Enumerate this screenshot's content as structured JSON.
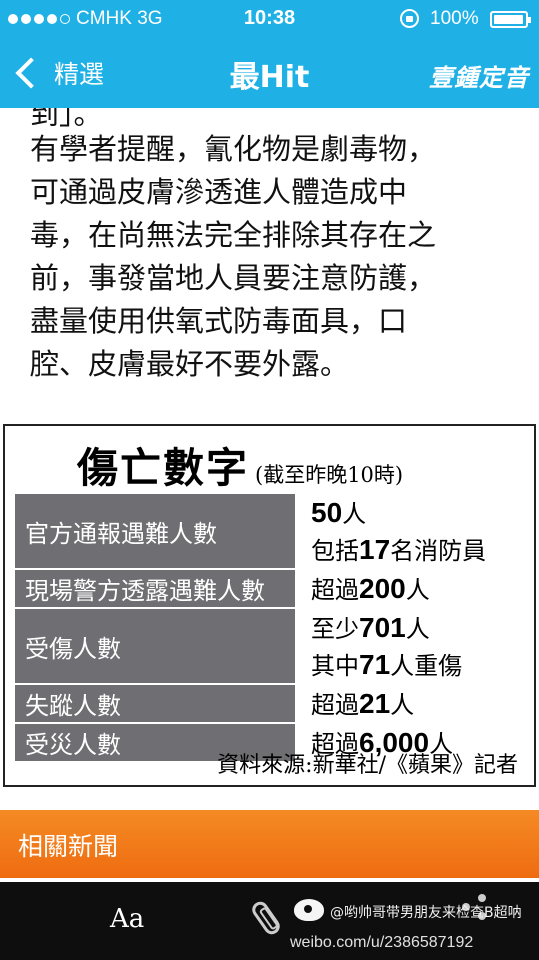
{
  "status_bar": {
    "carrier": "CMHK   3G",
    "time": "10:38",
    "battery": "100%"
  },
  "nav": {
    "back_label": "精選",
    "title": "最Hit",
    "brand": "壹鍾定音"
  },
  "article": {
    "previous_line_fragment": "到」。",
    "paragraph_lines": [
      "有學者提醒，氰化物是劇毒物，",
      "可通過皮膚滲透進人體造成中",
      "毒，在尚無法完全排除其存在之",
      "前，事發當地人員要注意防護，",
      "盡量使用供氧式防毒面具，口",
      "腔、皮膚最好不要外露。"
    ]
  },
  "casualty_table": {
    "title": "傷亡數字",
    "note": "(截至昨晚10時)",
    "rows": [
      {
        "label": "官方通報遇難人數",
        "lines": [
          {
            "pre": "",
            "num": "50",
            "post": "人"
          },
          {
            "pre": "包括",
            "num": "17",
            "post": "名消防員"
          }
        ]
      },
      {
        "label": "現場警方透露遇難人數",
        "lines": [
          {
            "pre": "超過",
            "num": "200",
            "post": "人"
          }
        ]
      },
      {
        "label": "受傷人數",
        "lines": [
          {
            "pre": "至少",
            "num": "701",
            "post": "人"
          },
          {
            "pre": "其中",
            "num": "71",
            "post": "人重傷"
          }
        ]
      },
      {
        "label": "失蹤人數",
        "lines": [
          {
            "pre": "超過",
            "num": "21",
            "post": "人"
          }
        ]
      },
      {
        "label": "受災人數",
        "lines": [
          {
            "pre": "超過",
            "num": "6,000",
            "post": "人"
          }
        ]
      }
    ],
    "source": "資料來源:新華社/《蘋果》記者"
  },
  "related_news": {
    "label": "相關新聞"
  },
  "toolbar": {
    "font_size_label": "Aa",
    "watermark_handle": "@哟帅哥带男朋友来检查B超呐",
    "watermark_url": "weibo.com/u/2386587192"
  },
  "colors": {
    "header": "#1fb1e6",
    "related_bar": "#ef6c10",
    "table_label_bg": "#6f6f73",
    "toolbar": "#0e0e0e"
  }
}
